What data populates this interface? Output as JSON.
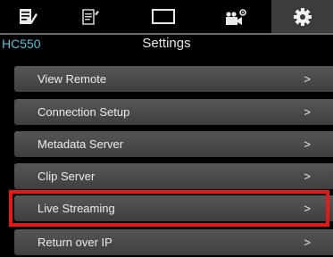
{
  "tabs": [
    {
      "icon": "clip-list-icon"
    },
    {
      "icon": "clip-edit-icon"
    },
    {
      "icon": "screen-icon"
    },
    {
      "icon": "camera-settings-icon"
    },
    {
      "icon": "gear-icon",
      "active": true
    }
  ],
  "header": {
    "model": "HC550",
    "title": "Settings"
  },
  "menu": [
    {
      "label": "View Remote",
      "arrow": ">"
    },
    {
      "label": "Connection Setup",
      "arrow": ">"
    },
    {
      "label": "Metadata Server",
      "arrow": ">"
    },
    {
      "label": "Clip Server",
      "arrow": ">"
    },
    {
      "label": "Live Streaming",
      "arrow": ">",
      "highlighted": true
    },
    {
      "label": "Return over IP",
      "arrow": ">"
    }
  ],
  "colors": {
    "model_text": "#4fc3d9",
    "highlight_border": "#e41a1a",
    "active_tab": "#3c3c3c"
  }
}
